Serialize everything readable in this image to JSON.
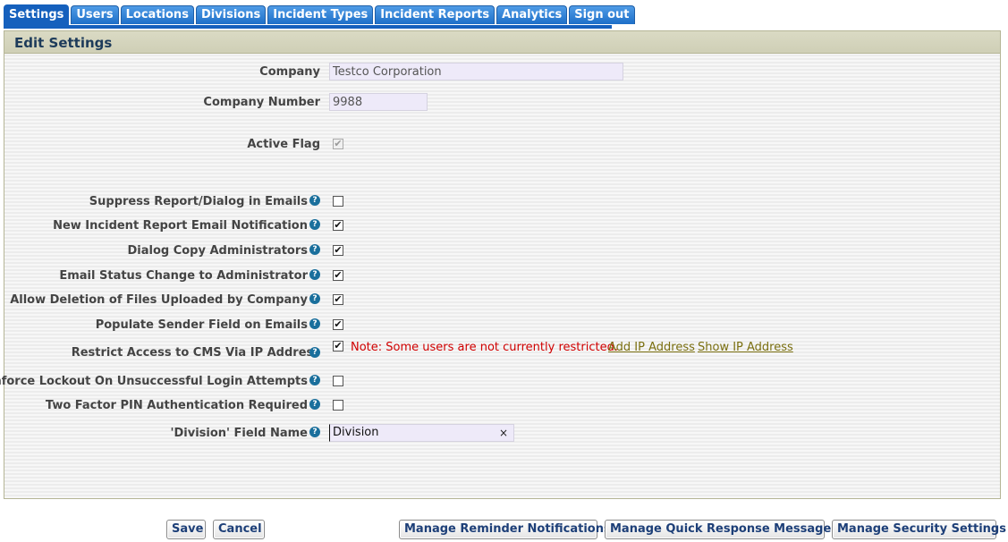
{
  "tabs": [
    "Settings",
    "Users",
    "Locations",
    "Divisions",
    "Incident Types",
    "Incident Reports",
    "Analytics",
    "Sign out"
  ],
  "panel": {
    "title": "Edit Settings"
  },
  "company": {
    "label": "Company",
    "value": "Testco Corporation"
  },
  "company_number": {
    "label": "Company Number",
    "value": "9988"
  },
  "active_flag": {
    "label": "Active Flag",
    "checked": true
  },
  "options": [
    {
      "label": "Suppress Report/Dialog in Emails",
      "checked": false
    },
    {
      "label": "New Incident Report Email Notification",
      "checked": true
    },
    {
      "label": "Dialog Copy Administrators",
      "checked": true
    },
    {
      "label": "Email Status Change to Administrator",
      "checked": true
    },
    {
      "label": "Allow Deletion of Files Uploaded by Company",
      "checked": true
    },
    {
      "label": "Populate Sender Field on Emails",
      "checked": true
    },
    {
      "label": "Restrict Access to CMS Via IP Address",
      "checked": true
    },
    {
      "label": "Enforce Lockout On Unsuccessful Login Attempts",
      "checked": false
    },
    {
      "label": "Two Factor PIN Authentication Required",
      "checked": false
    }
  ],
  "ip_restriction": {
    "note": "Note: Some users are not currently restricted.",
    "add_link": "Add IP Address",
    "show_link": "Show IP Address"
  },
  "division_field": {
    "label": "'Division' Field Name",
    "value": "Division",
    "clear": "×"
  },
  "help_glyph": "?",
  "check_glyph": "✔",
  "buttons": {
    "save": "Save",
    "cancel": "Cancel",
    "reminders": "Manage Reminder Notifications",
    "quick_response": "Manage Quick Response Messages",
    "security": "Manage Security Settings"
  }
}
